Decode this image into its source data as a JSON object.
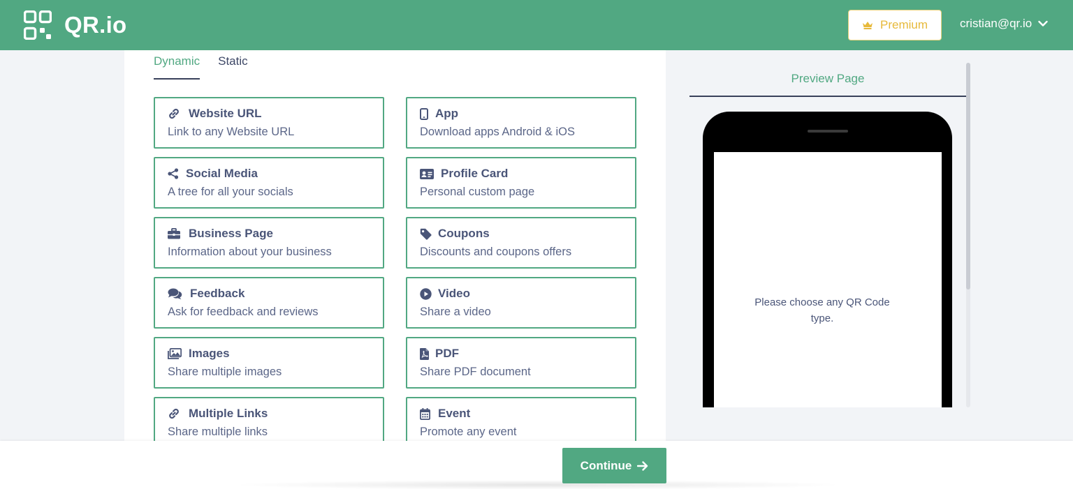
{
  "app": {
    "name": "QR.io"
  },
  "header": {
    "premium_label": "Premium",
    "user_email": "cristian@qr.io"
  },
  "tabs": [
    {
      "label": "Dynamic",
      "active": true
    },
    {
      "label": "Static",
      "active": false
    }
  ],
  "qr_types": [
    {
      "title": "Website URL",
      "description": "Link to any Website URL",
      "icon": "link-icon"
    },
    {
      "title": "App",
      "description": "Download apps Android & iOS",
      "icon": "mobile-icon"
    },
    {
      "title": "Social Media",
      "description": "A tree for all your socials",
      "icon": "share-icon"
    },
    {
      "title": "Profile Card",
      "description": "Personal custom page",
      "icon": "id-card-icon"
    },
    {
      "title": "Business Page",
      "description": "Information about your business",
      "icon": "briefcase-icon"
    },
    {
      "title": "Coupons",
      "description": "Discounts and coupons offers",
      "icon": "tag-icon"
    },
    {
      "title": "Feedback",
      "description": "Ask for feedback and reviews",
      "icon": "comments-icon"
    },
    {
      "title": "Video",
      "description": "Share a video",
      "icon": "play-circle-icon"
    },
    {
      "title": "Images",
      "description": "Share multiple images",
      "icon": "images-icon"
    },
    {
      "title": "PDF",
      "description": "Share PDF document",
      "icon": "pdf-file-icon"
    },
    {
      "title": "Multiple Links",
      "description": "Share multiple links",
      "icon": "link-icon"
    },
    {
      "title": "Event",
      "description": "Promote any event",
      "icon": "calendar-icon"
    }
  ],
  "preview": {
    "title": "Preview Page",
    "message": "Please choose any QR Code type."
  },
  "footer": {
    "continue_label": "Continue"
  },
  "colors": {
    "brand": "#51a882",
    "premium": "#e7b93a",
    "text": "#4a5578",
    "background": "#f2f4f7"
  }
}
